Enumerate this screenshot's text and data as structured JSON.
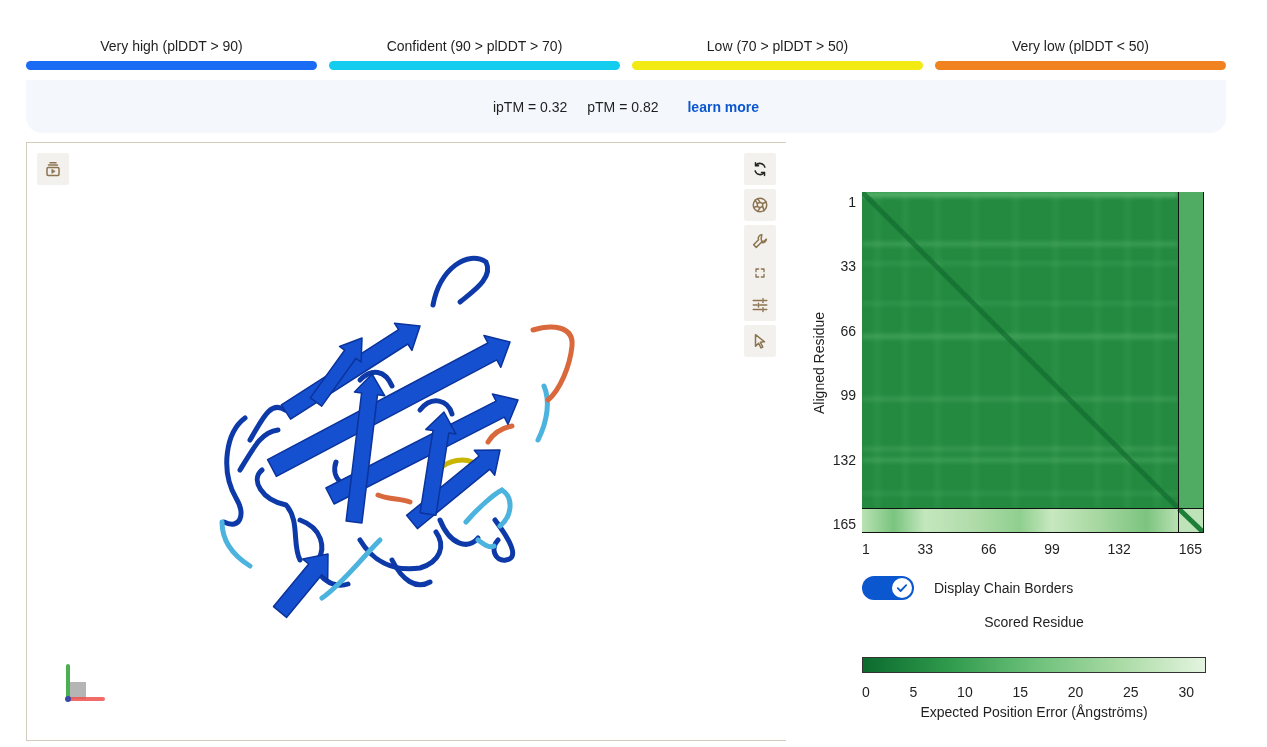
{
  "confidence_legend": [
    {
      "label": "Very high (plDDT > 90)",
      "color": "#1a6cf4"
    },
    {
      "label": "Confident (90 > plDDT > 70)",
      "color": "#14cdee"
    },
    {
      "label": "Low (70 > plDDT > 50)",
      "color": "#f2ea12"
    },
    {
      "label": "Very low (plDDT < 50)",
      "color": "#f0821f"
    }
  ],
  "scores": {
    "metrics": [
      "ipTM = 0.32",
      "pTM = 0.82"
    ],
    "link": "learn more"
  },
  "pae_plot": {
    "y_axis_label": "Aligned Residue",
    "y_ticks": [
      "1",
      "33",
      "66",
      "99",
      "132",
      "165"
    ],
    "x_ticks": [
      "1",
      "33",
      "66",
      "99",
      "132",
      "165"
    ],
    "chain_borders_toggle": {
      "label": "Display Chain Borders",
      "on": true
    },
    "x_axis_label": "Scored Residue",
    "color_scale": {
      "ticks": [
        "0",
        "5",
        "10",
        "15",
        "20",
        "25",
        "30"
      ],
      "label": "Expected Position Error (Ångströms)"
    }
  }
}
